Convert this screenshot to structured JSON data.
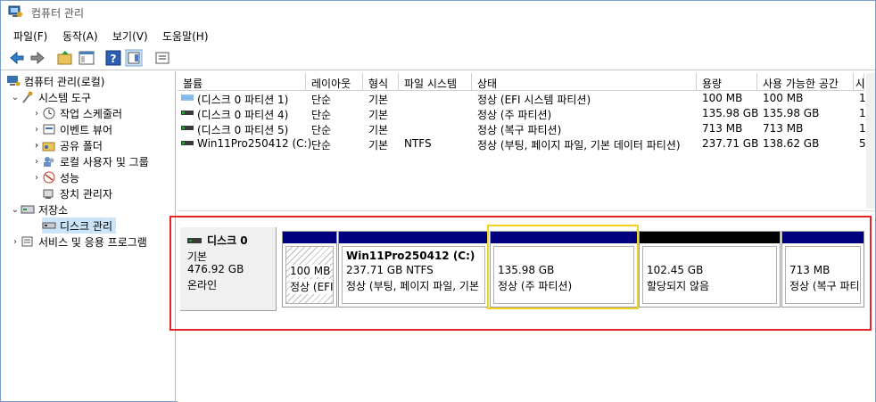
{
  "window": {
    "title": "컴퓨터 관리"
  },
  "menu": [
    "파일(F)",
    "동작(A)",
    "보기(V)",
    "도움말(H)"
  ],
  "tree": {
    "root": "컴퓨터 관리(로컬)",
    "system_tools": "시스템 도구",
    "task_scheduler": "작업 스케줄러",
    "event_viewer": "이벤트 뷰어",
    "shared_folders": "공유 폴더",
    "local_users": "로컬 사용자 및 그룹",
    "performance": "성능",
    "device_manager": "장치 관리자",
    "storage": "저장소",
    "disk_management": "디스크 관리",
    "services": "서비스 및 응용 프로그램"
  },
  "columns": [
    "볼륨",
    "레이아웃",
    "형식",
    "파일 시스템",
    "상태",
    "용량",
    "사용 가능한 공간",
    "사"
  ],
  "volumes": [
    {
      "name": "(디스크 0 파티션 1)",
      "layout": "단순",
      "type": "기본",
      "fs": "",
      "status": "정상 (EFI 시스템 파티션)",
      "capacity": "100 MB",
      "free": "100 MB",
      "pct": "1"
    },
    {
      "name": "(디스크 0 파티션 4)",
      "layout": "단순",
      "type": "기본",
      "fs": "",
      "status": "정상 (주 파티션)",
      "capacity": "135.98 GB",
      "free": "135.98 GB",
      "pct": "1"
    },
    {
      "name": "(디스크 0 파티션 5)",
      "layout": "단순",
      "type": "기본",
      "fs": "",
      "status": "정상 (복구 파티션)",
      "capacity": "713 MB",
      "free": "713 MB",
      "pct": "1"
    },
    {
      "name": "Win11Pro250412 (C:)",
      "layout": "단순",
      "type": "기본",
      "fs": "NTFS",
      "status": "정상 (부팅, 페이지 파일, 기본 데이터 파티션)",
      "capacity": "237.71 GB",
      "free": "138.62 GB",
      "pct": "5"
    }
  ],
  "disk": {
    "name": "디스크 0",
    "type": "기본",
    "size": "476.92 GB",
    "state": "온라인",
    "partitions": [
      {
        "size": "100 MB",
        "status": "정상 (EFI",
        "title": ""
      },
      {
        "title": "Win11Pro250412  (C:)",
        "size": "237.71 GB NTFS",
        "status": "정상 (부팅, 페이지 파일, 기본"
      },
      {
        "size": "135.98 GB",
        "status": "정상 (주 파티션)",
        "title": ""
      },
      {
        "size": "102.45 GB",
        "status": "할당되지 않음",
        "title": ""
      },
      {
        "size": "713 MB",
        "status": "정상 (복구 파티",
        "title": ""
      }
    ]
  },
  "colors": {
    "primary_bar": "#00007f",
    "unallocated_bar": "#000000",
    "highlight_red": "#e0282b",
    "highlight_yellow": "#f5d21f"
  }
}
